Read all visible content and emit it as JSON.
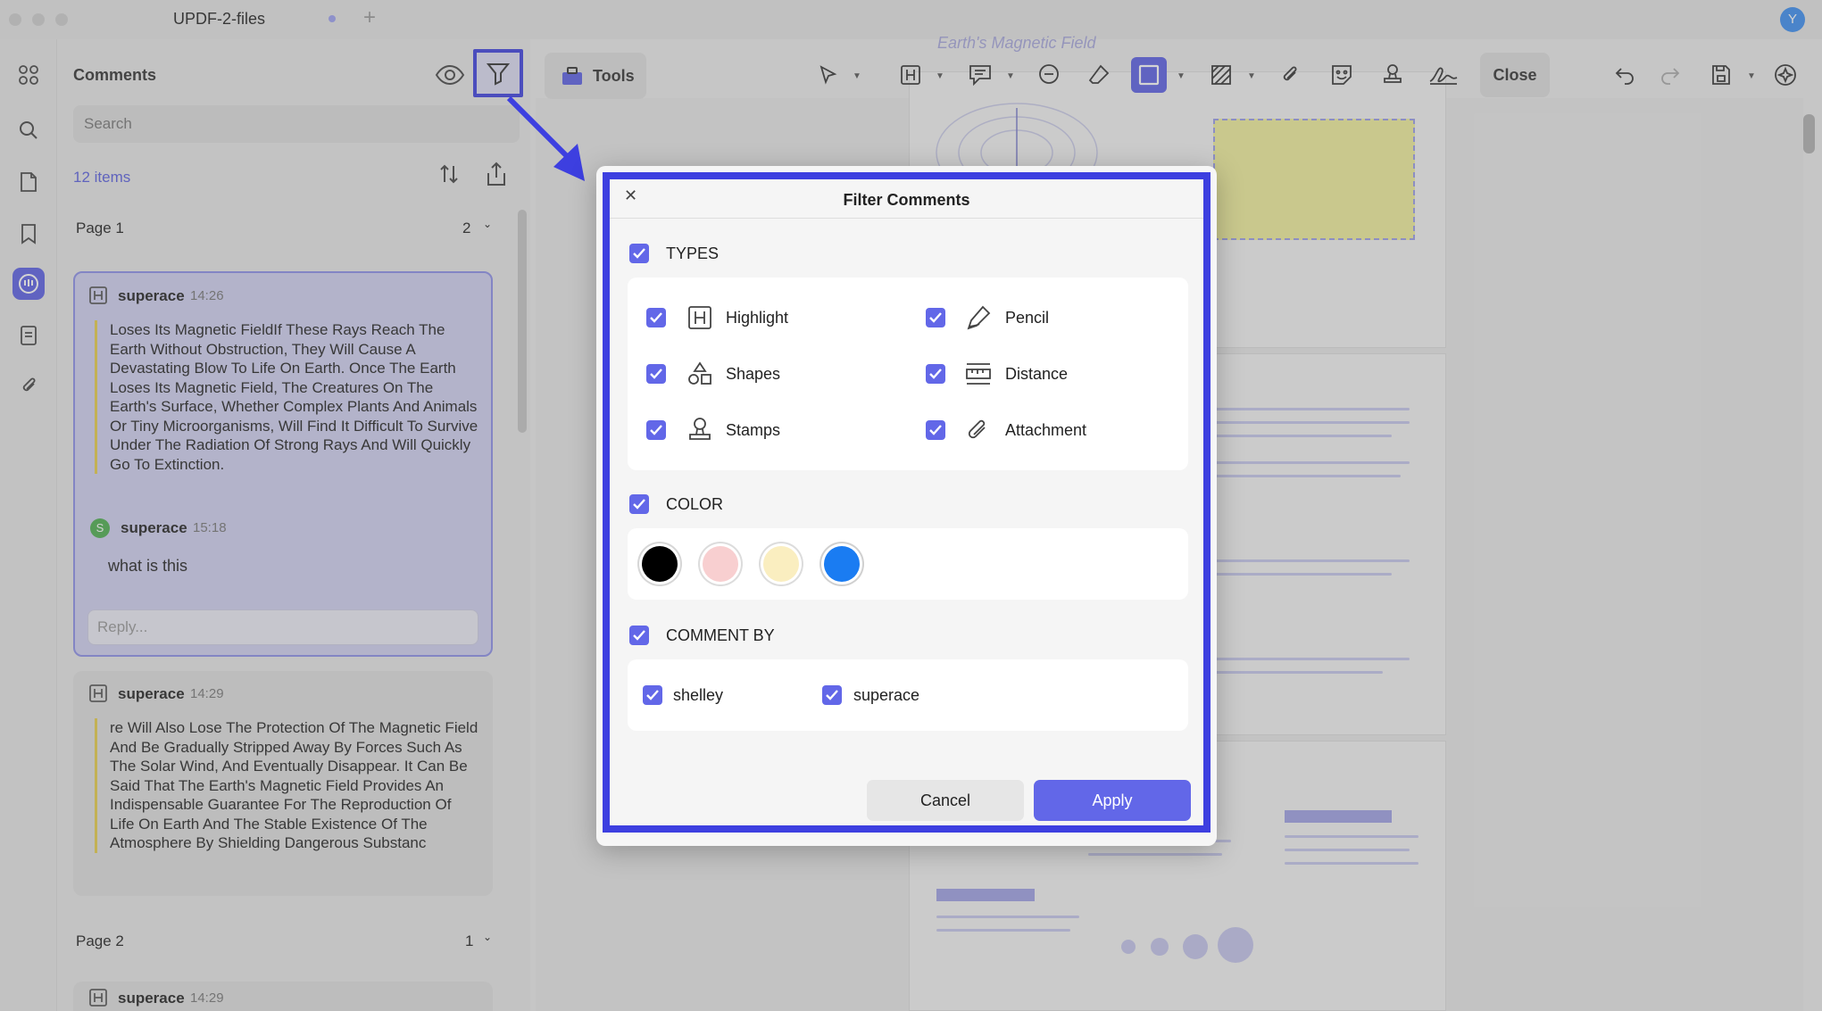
{
  "app": {
    "tab_title": "UPDF-2-files",
    "user_initial": "Y"
  },
  "panel": {
    "title": "Comments",
    "search_placeholder": "Search",
    "items_count": "12 items",
    "page1": {
      "label": "Page 1",
      "count": "2"
    },
    "page2": {
      "label": "Page 2",
      "count": "1"
    },
    "comments": [
      {
        "user": "superace",
        "time": "14:26",
        "text": "Loses Its Magnetic FieldIf These Rays Reach The Earth Without Obstruction, They Will Cause A Devastating Blow To Life On Earth. Once The Earth Loses Its Magnetic Field, The Creatures On The Earth's Surface, Whether Complex Plants And Animals Or Tiny Microorganisms, Will Find It Difficult To Survive Under The Radiation Of Strong Rays And Will Quickly Go To Extinction."
      },
      {
        "user": "superace",
        "time": "14:29",
        "text": "re Will Also Lose The Protection Of The Magnetic Field And Be Gradually Stripped Away By Forces Such As The Solar Wind, And Eventually Disappear. It Can Be Said That The Earth's Magnetic Field Provides An Indispensable Guarantee For The Reproduction Of Life On Earth And The Stable Existence Of The Atmosphere By Shielding Dangerous Substanc"
      },
      {
        "user": "superace",
        "time": "14:29"
      }
    ],
    "reply": {
      "avatar": "S",
      "user": "superace",
      "time": "15:18",
      "text": "what is this",
      "placeholder": "Reply..."
    }
  },
  "toolbar": {
    "tools_label": "Tools",
    "close_label": "Close"
  },
  "document": {
    "heading": "Earth's Magnetic Field"
  },
  "dialog": {
    "title": "Filter Comments",
    "types": {
      "label": "TYPES",
      "items": [
        {
          "label": "Highlight",
          "icon": "highlight-icon",
          "checked": true
        },
        {
          "label": "Pencil",
          "icon": "pencil-icon",
          "checked": true
        },
        {
          "label": "Shapes",
          "icon": "shapes-icon",
          "checked": true
        },
        {
          "label": "Distance",
          "icon": "distance-icon",
          "checked": true
        },
        {
          "label": "Stamps",
          "icon": "stamp-icon",
          "checked": true
        },
        {
          "label": "Attachment",
          "icon": "attachment-icon",
          "checked": true
        }
      ]
    },
    "color": {
      "label": "COLOR",
      "swatches": [
        "#000000",
        "#f8cfd0",
        "#faeec0",
        "#1a7cf2"
      ]
    },
    "comment_by": {
      "label": "COMMENT BY",
      "users": [
        "shelley",
        "superace"
      ]
    },
    "cancel_label": "Cancel",
    "apply_label": "Apply"
  },
  "colors": {
    "accent": "#6267e8",
    "highlight_frame": "#3d3fe0"
  }
}
